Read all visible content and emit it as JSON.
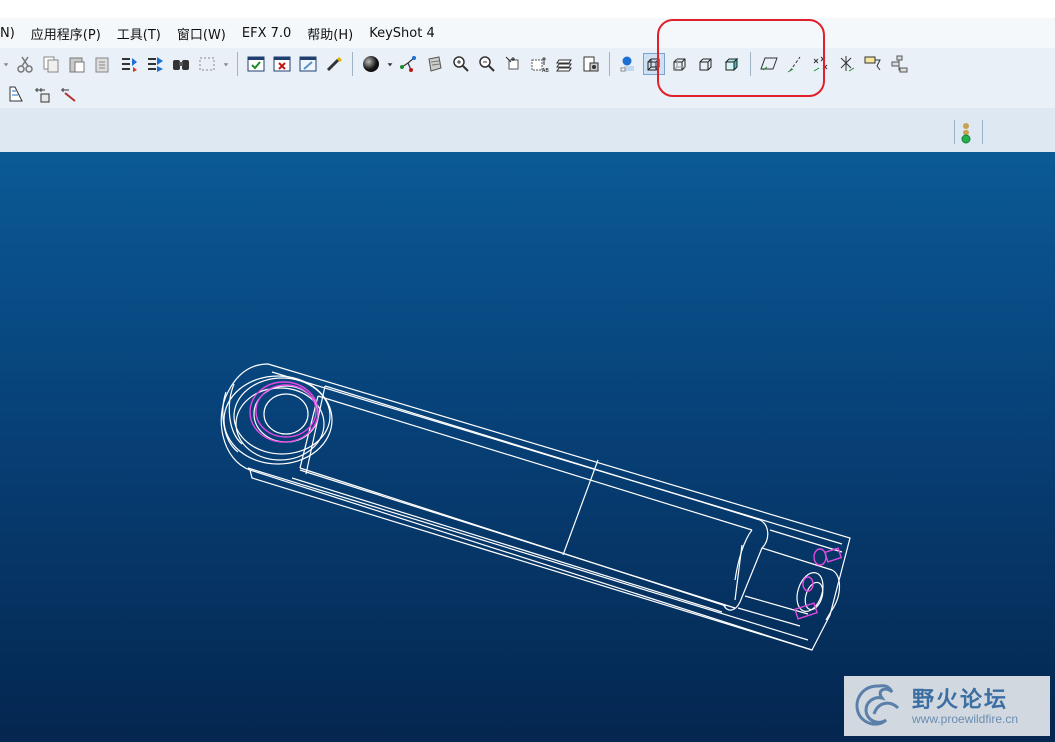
{
  "menu": [
    {
      "label": "N)"
    },
    {
      "label": "应用程序(P)"
    },
    {
      "label": "工具(T)"
    },
    {
      "label": "窗口(W)"
    },
    {
      "label": "EFX 7.0"
    },
    {
      "label": "帮助(H)"
    },
    {
      "label": "KeyShot 4"
    }
  ],
  "toolbar": {
    "row1_icons": [
      "dropdown-arrow-icon",
      "cut-icon",
      "copy-icon",
      "paste-icon",
      "paste-special-icon",
      "regenerate-icon",
      "regenerate-manager-icon",
      "find-icon",
      "select-box-icon",
      "dropdown-arrow-icon",
      "window-activate-icon",
      "window-close-icon",
      "repaint-icon",
      "spin-center-icon",
      "orient-mode-icon",
      "dropdown-arrow-icon",
      "zoom-icon",
      "zoom-in-icon",
      "zoom-out-icon",
      "refit-icon",
      "reorient-icon",
      "saved-views-icon",
      "layers-icon",
      "view-manager-icon"
    ],
    "display_style_icons": [
      "shading-icon",
      "wireframe-icon",
      "hidden-line-icon",
      "no-hidden-icon",
      "shaded-icon"
    ],
    "datum_icons": [
      "datum-planes-icon",
      "datum-axes-icon",
      "datum-points-icon",
      "coordinate-systems-icon",
      "annotations-icon",
      "model-tree-icon"
    ],
    "row2_icons": [
      "measure-icon",
      "analysis-icon",
      "sketch-icon"
    ]
  },
  "status": {
    "signal": "green-light"
  },
  "watermark": {
    "title": "野火论坛",
    "url": "www.proewildfire.cn"
  },
  "colors": {
    "accent_highlight": "#e0202a",
    "viewport_top": "#0b5a96",
    "viewport_bottom": "#04264f",
    "edge": "#ffffff",
    "hole_edge": "#e14adf"
  }
}
